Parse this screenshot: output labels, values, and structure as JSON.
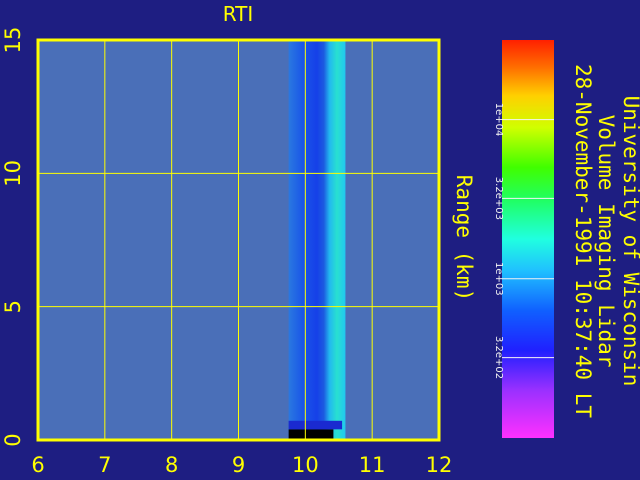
{
  "colors": {
    "background": "#1e1e82",
    "axis": "#ffff00",
    "plot_bg": "#4a6fb8",
    "bar_ticks": "#f4f4f4"
  },
  "chart_data": {
    "type": "heatmap",
    "title": "RTI",
    "xlabel": "",
    "ylabel": "Range (km)",
    "xlim": [
      6,
      12
    ],
    "ylim": [
      0,
      15
    ],
    "x_ticks": [
      "6",
      "7",
      "8",
      "9",
      "10",
      "11",
      "12"
    ],
    "y_ticks": [
      "0",
      "5",
      "10",
      "15"
    ],
    "grid": true,
    "data_extent": {
      "x_start": 9.75,
      "x_end": 10.6,
      "y_start": 0,
      "y_end": 15
    },
    "colorbar": {
      "ticks": [
        "1e+04",
        "3.2e+03",
        "1e+03",
        "3.2e+02"
      ],
      "tick_values": [
        10000,
        3200,
        1000,
        320
      ],
      "range_log10": [
        2,
        4.5
      ],
      "colormap": "rainbow"
    },
    "annotations": [
      "University of Wisconsin",
      "Volume Imaging Lidar",
      "28-November-1991 10:37:40 LT"
    ]
  }
}
